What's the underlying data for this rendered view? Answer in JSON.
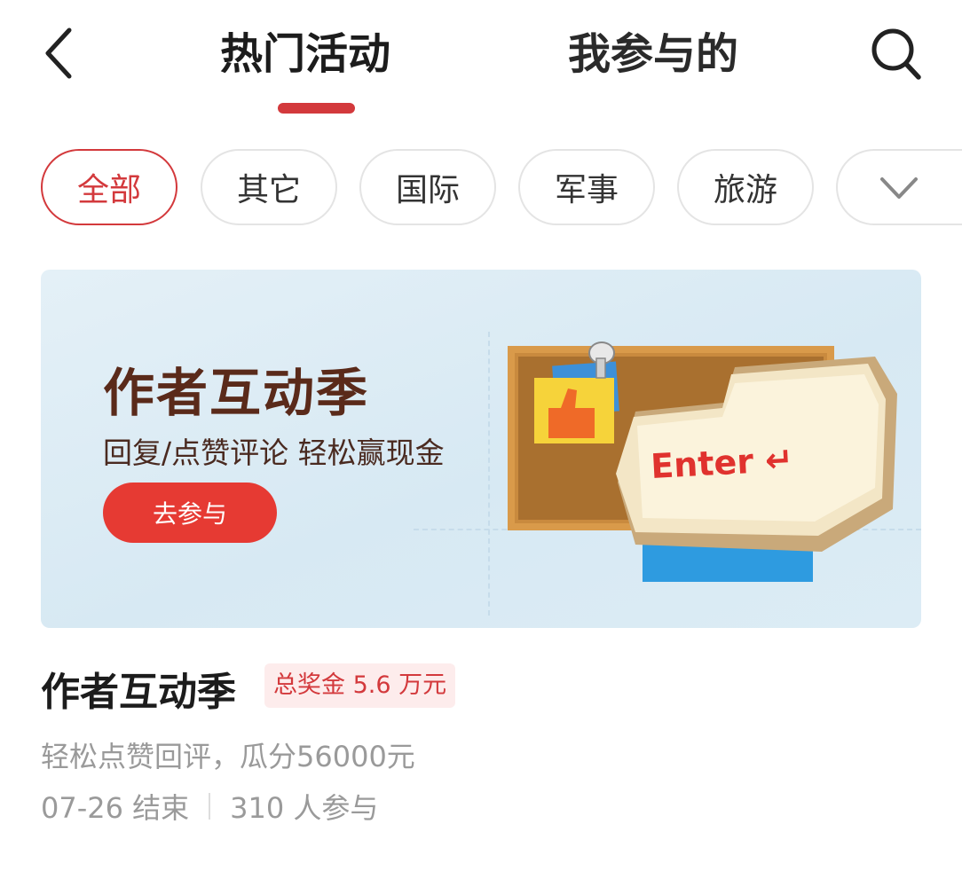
{
  "header": {
    "tabs": [
      {
        "label": "热门活动",
        "active": true
      },
      {
        "label": "我参与的",
        "active": false
      }
    ],
    "back_icon": "chevron-left-icon",
    "search_icon": "search-icon",
    "accent_color": "#d3393c"
  },
  "filters": {
    "chips": [
      "全部",
      "其它",
      "国际",
      "军事",
      "旅游"
    ],
    "selected": "全部",
    "more_icon": "chevron-down-icon"
  },
  "banner": {
    "title": "作者互动季",
    "subtitle": "回复/点赞评论 轻松赢现金",
    "button_label": "去参与",
    "key_label": "Enter ↵",
    "button_color": "#e63a33"
  },
  "activity": {
    "title": "作者互动季",
    "prize": "总奖金 5.6 万元",
    "description": "轻松点赞回评，瓜分56000元",
    "end_date": "07-26 结束",
    "participants": "310 人参与"
  }
}
